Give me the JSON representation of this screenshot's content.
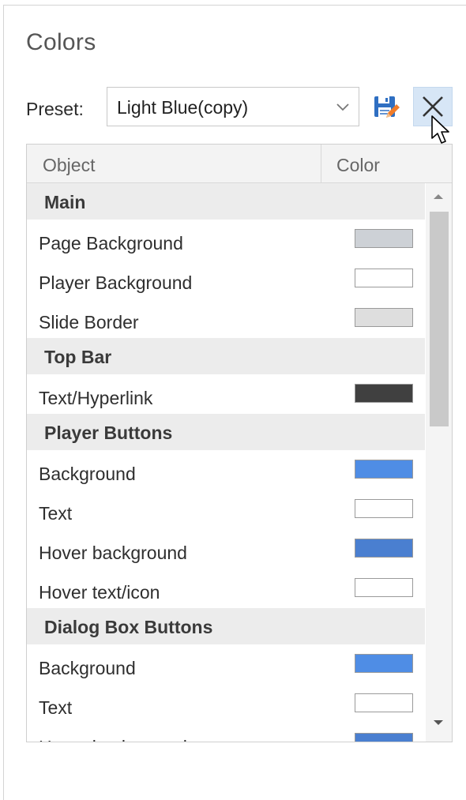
{
  "panel": {
    "title": "Colors",
    "preset_label": "Preset:",
    "preset_value": "Light Blue(copy)"
  },
  "grid": {
    "col_object": "Object",
    "col_color": "Color",
    "rows": [
      {
        "type": "group",
        "label": "Main"
      },
      {
        "type": "item",
        "label": "Page Background",
        "color": "#cdd1d6"
      },
      {
        "type": "item",
        "label": "Player Background",
        "color": "#ffffff"
      },
      {
        "type": "item",
        "label": "Slide Border",
        "color": "#dedede"
      },
      {
        "type": "group",
        "label": "Top Bar"
      },
      {
        "type": "item",
        "label": "Text/Hyperlink",
        "color": "#404040"
      },
      {
        "type": "group",
        "label": "Player Buttons"
      },
      {
        "type": "item",
        "label": "Background",
        "color": "#4f8de5"
      },
      {
        "type": "item",
        "label": "Text",
        "color": "#ffffff"
      },
      {
        "type": "item",
        "label": "Hover background",
        "color": "#4a7fd0"
      },
      {
        "type": "item",
        "label": "Hover text/icon",
        "color": "#ffffff"
      },
      {
        "type": "group",
        "label": "Dialog Box Buttons"
      },
      {
        "type": "item",
        "label": "Background",
        "color": "#4f8de5"
      },
      {
        "type": "item",
        "label": "Text",
        "color": "#ffffff"
      },
      {
        "type": "item",
        "label": "Hover background",
        "color": "#4a7fd0"
      }
    ]
  },
  "icons": {
    "save": "save-icon",
    "delete": "close-icon",
    "dropdown": "chevron-down-icon",
    "cursor": "mouse-cursor-icon",
    "scroll_up": "scroll-up-arrow-icon",
    "scroll_down": "scroll-down-arrow-icon"
  },
  "colors": {
    "accent": "#4f8de5",
    "selected_button_bg": "#d7e6f6",
    "group_row_bg": "#ececec",
    "header_bg": "#f3f3f3"
  }
}
